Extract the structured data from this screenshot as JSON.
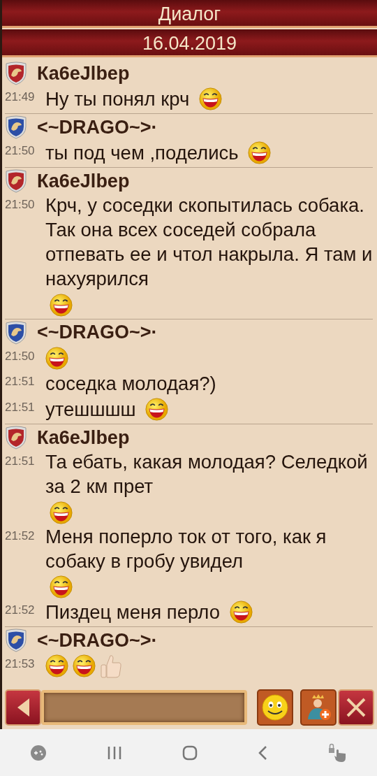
{
  "title": "Диалог",
  "date": "16.04.2019",
  "groups": [
    {
      "sender": "Ка6еJlbep",
      "color": "#b3262a",
      "messages": [
        {
          "time": "21:49",
          "text": "Ну ты понял крч",
          "emojis": [
            {
              "kind": "grin"
            }
          ]
        }
      ]
    },
    {
      "sender": "<~DRAGO~>·",
      "color": "#2d4fa6",
      "messages": [
        {
          "time": "21:50",
          "text": "ты под чем ,поделись",
          "emojis": [
            {
              "kind": "grin"
            }
          ]
        }
      ]
    },
    {
      "sender": "Ка6еJlbep",
      "color": "#b3262a",
      "messages": [
        {
          "time": "21:50",
          "text": "Крч, у соседки скопытилась собака. Так она всех соседей собрала отпевать ее и чтол накрыла. Я там и нахуярился",
          "emojis": [
            {
              "kind": "grin"
            }
          ]
        }
      ]
    },
    {
      "sender": "<~DRAGO~>·",
      "color": "#2d4fa6",
      "messages": [
        {
          "time": "21:50",
          "emojis": [
            {
              "kind": "grin"
            }
          ]
        },
        {
          "time": "21:51",
          "text": "соседка молодая?)"
        },
        {
          "time": "21:51",
          "text": "утешшшш",
          "emojis": [
            {
              "kind": "grin"
            }
          ]
        }
      ]
    },
    {
      "sender": "Ка6еJlbep",
      "color": "#b3262a",
      "messages": [
        {
          "time": "21:51",
          "text": "Та ебать, какая молодая? Селедкой за 2 км прет",
          "emojis": [
            {
              "kind": "grin"
            }
          ]
        },
        {
          "time": "21:52",
          "text": "Меня поперло ток от того, как я собаку в гробу увидел",
          "emojis": [
            {
              "kind": "grin"
            }
          ]
        },
        {
          "time": "21:52",
          "text": "Пиздец меня перло",
          "emojis": [
            {
              "kind": "grin"
            }
          ]
        }
      ]
    },
    {
      "sender": "<~DRAGO~>·",
      "color": "#2d4fa6",
      "messages": [
        {
          "time": "21:53",
          "emojis": [
            {
              "kind": "grin"
            },
            {
              "kind": "grin"
            },
            {
              "kind": "thumbs-up"
            }
          ]
        }
      ]
    }
  ]
}
